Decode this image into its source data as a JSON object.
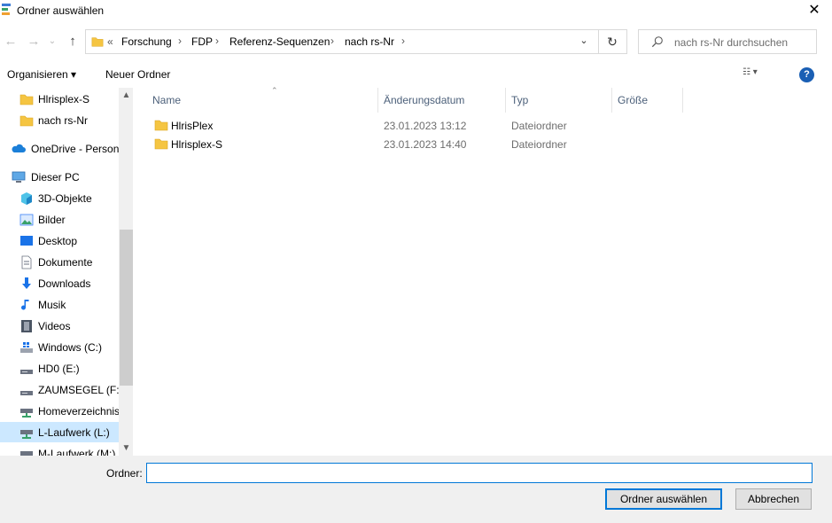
{
  "window": {
    "title": "Ordner auswählen",
    "close_glyph": "✕",
    "accent": "#0078d7"
  },
  "nav": {
    "back_glyph": "←",
    "forward_glyph": "→",
    "recent_glyph": "⌄",
    "up_glyph": "↑"
  },
  "address": {
    "overflow": "«",
    "crumbs": [
      "Forschung",
      "FDP",
      "Referenz-Sequenzen",
      "nach rs-Nr"
    ],
    "separator": "›",
    "dropdown_glyph": "⌄",
    "refresh_glyph": "↻"
  },
  "search": {
    "placeholder": "nach rs-Nr durchsuchen",
    "icon": "search-icon"
  },
  "toolbar": {
    "organize": "Organisieren ▾",
    "new_folder": "Neuer Ordner",
    "view_glyph": "☷ ▾",
    "help": "?"
  },
  "sidebar": {
    "items": [
      {
        "label": "Hlrisplex-S",
        "icon": "folder-icon"
      },
      {
        "label": "nach rs-Nr",
        "icon": "folder-icon"
      },
      {
        "label": "OneDrive - Persona",
        "icon": "onedrive-icon"
      },
      {
        "label": "Dieser PC",
        "icon": "computer-icon"
      },
      {
        "label": "3D-Objekte",
        "icon": "cube-icon"
      },
      {
        "label": "Bilder",
        "icon": "pictures-icon"
      },
      {
        "label": "Desktop",
        "icon": "desktop-icon"
      },
      {
        "label": "Dokumente",
        "icon": "documents-icon"
      },
      {
        "label": "Downloads",
        "icon": "download-icon"
      },
      {
        "label": "Musik",
        "icon": "music-icon"
      },
      {
        "label": "Videos",
        "icon": "videos-icon"
      },
      {
        "label": "Windows (C:)",
        "icon": "system-drive-icon"
      },
      {
        "label": "HD0 (E:)",
        "icon": "drive-icon"
      },
      {
        "label": "ZAUMSEGEL (F:)",
        "icon": "drive-icon"
      },
      {
        "label": "Homeverzeichnis",
        "icon": "network-drive-icon"
      },
      {
        "label": "L-Laufwerk (L:)",
        "icon": "network-drive-icon"
      },
      {
        "label": "M-Laufwerk (M:)",
        "icon": "network-drive-icon"
      }
    ],
    "selected_index": 15
  },
  "filelist": {
    "columns": [
      "Name",
      "Änderungsdatum",
      "Typ",
      "Größe"
    ],
    "rows": [
      {
        "name": "HlrisPlex",
        "date": "23.01.2023 13:12",
        "type": "Dateiordner",
        "size": ""
      },
      {
        "name": "Hlrisplex-S",
        "date": "23.01.2023 14:40",
        "type": "Dateiordner",
        "size": ""
      }
    ]
  },
  "footer": {
    "folder_label": "Ordner:",
    "folder_value": "",
    "select_button": "Ordner auswählen",
    "cancel_button": "Abbrechen"
  }
}
